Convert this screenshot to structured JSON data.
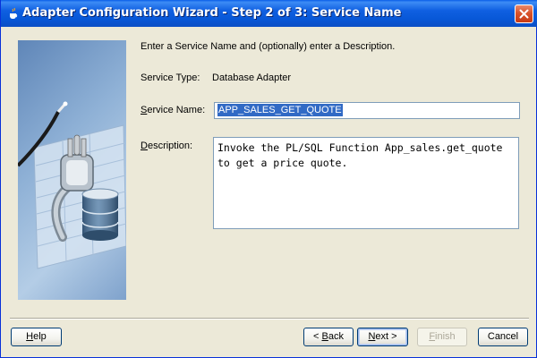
{
  "window": {
    "title": "Adapter Configuration Wizard - Step 2 of 3: Service Name"
  },
  "content": {
    "instructions": "Enter a Service Name and (optionally) enter a Description.",
    "service_type_label": "Service Type:",
    "service_type_value": "Database Adapter",
    "service_name_label_mnemonic": "S",
    "service_name_label_rest": "ervice Name:",
    "service_name_value": "APP_SALES_GET_QUOTE",
    "description_label_mnemonic": "D",
    "description_label_rest": "escription:",
    "description_value": "Invoke the PL/SQL Function App_sales.get_quote\nto get a price quote."
  },
  "buttons": {
    "help_mnemonic": "H",
    "help_rest": "elp",
    "back_prefix": "< ",
    "back_mnemonic": "B",
    "back_rest": "ack",
    "next_mnemonic": "N",
    "next_rest": "ext >",
    "finish_mnemonic": "F",
    "finish_rest": "inish",
    "cancel_label": "Cancel"
  },
  "colors": {
    "titlebar": "#0858d8",
    "selection": "#316ac5",
    "dialog_bg": "#ece9d8",
    "close_button": "#d9532b"
  },
  "icons": {
    "title_icon": "java-cup-icon",
    "close_icon": "close-x-icon",
    "illustration": "plug-and-database-illustration"
  }
}
